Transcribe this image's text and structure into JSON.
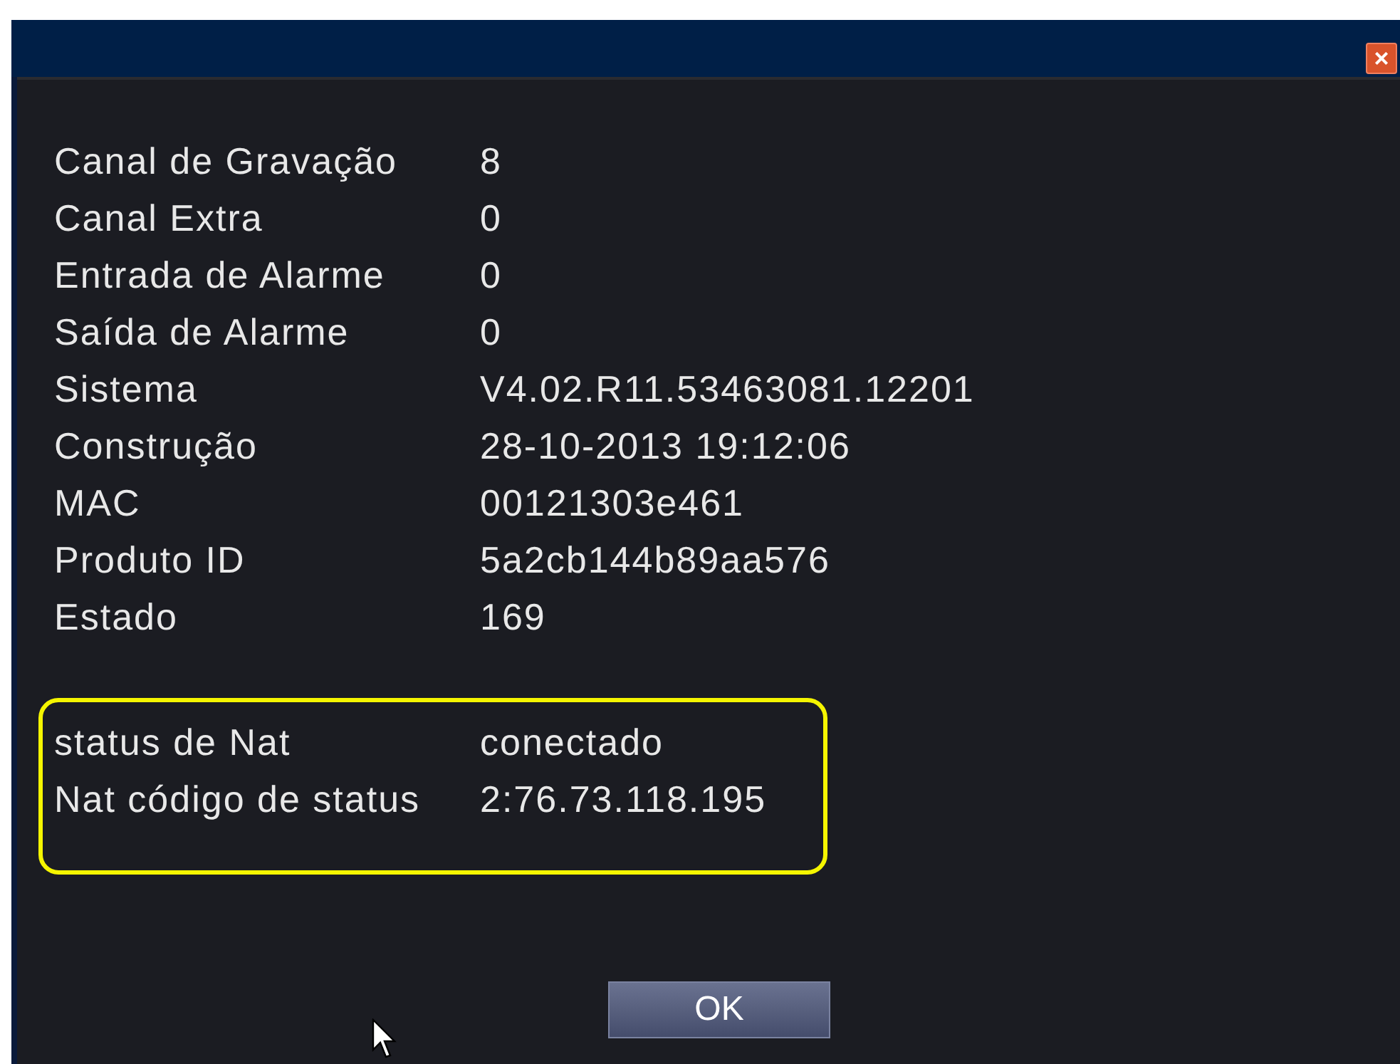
{
  "window": {
    "close_label": "×"
  },
  "groups": [
    {
      "highlighted": false,
      "rows": [
        {
          "label": "Canal de Gravação",
          "value": "8"
        },
        {
          "label": "Canal Extra",
          "value": "0"
        },
        {
          "label": "Entrada de Alarme",
          "value": "0"
        },
        {
          "label": "Saída de Alarme",
          "value": "0"
        },
        {
          "label": "Sistema",
          "value": "V4.02.R11.53463081.12201"
        },
        {
          "label": "Construção",
          "value": "28-10-2013 19:12:06"
        },
        {
          "label": "MAC",
          "value": "00121303e461"
        },
        {
          "label": "Produto ID",
          "value": "5a2cb144b89aa576"
        },
        {
          "label": "Estado",
          "value": "169"
        }
      ]
    },
    {
      "highlighted": true,
      "rows": [
        {
          "label": "status de Nat",
          "value": "conectado"
        },
        {
          "label": "Nat código de status",
          "value": "2:76.73.118.195"
        }
      ]
    }
  ],
  "buttons": [
    "OK"
  ]
}
